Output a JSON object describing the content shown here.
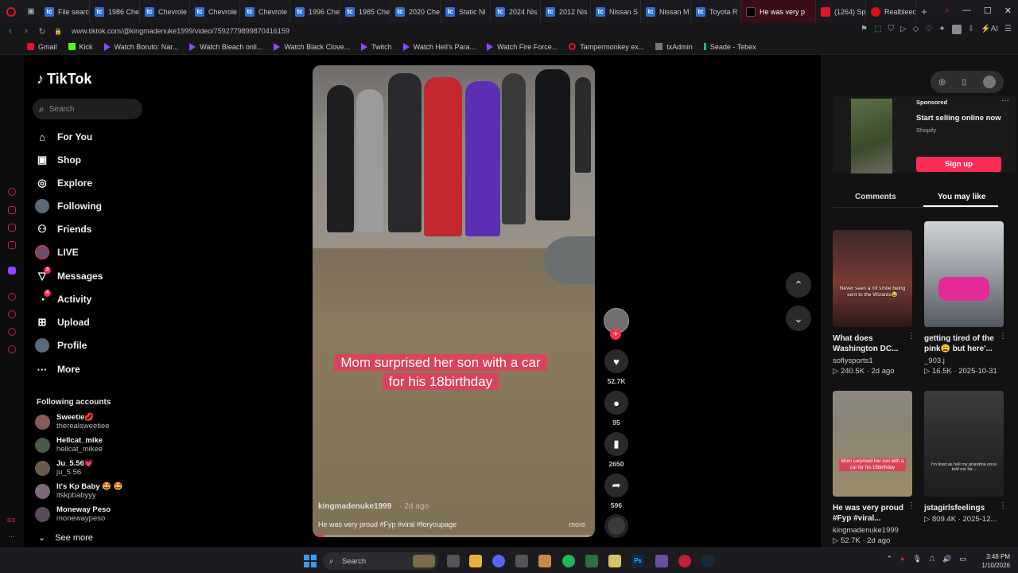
{
  "browser": {
    "tabs": [
      {
        "label": "File searc",
        "icon": "tc"
      },
      {
        "label": "1986 Che",
        "icon": "tc"
      },
      {
        "label": "Chevrole",
        "icon": "tc"
      },
      {
        "label": "Chevrole",
        "icon": "tc"
      },
      {
        "label": "Chevrole",
        "icon": "tc"
      },
      {
        "label": "1996 Che",
        "icon": "tc"
      },
      {
        "label": "1985 Che",
        "icon": "tc"
      },
      {
        "label": "2020 Che",
        "icon": "tc"
      },
      {
        "label": "Static Ni",
        "icon": "tc"
      },
      {
        "label": "2024 Nis",
        "icon": "tc"
      },
      {
        "label": "2012 Nis",
        "icon": "tc"
      },
      {
        "label": "Nissan S",
        "icon": "tc"
      },
      {
        "label": "Nissan M",
        "icon": "tc"
      },
      {
        "label": "Toyota R",
        "icon": "tc"
      },
      {
        "label": "He was very p",
        "icon": "tiktok",
        "active": true
      },
      {
        "label": "(1264) Sp",
        "icon": "youtube"
      },
      {
        "label": "Realbleed",
        "icon": "rb"
      }
    ],
    "url": "www.tiktok.com/@kingmadenuke1999/video/7592779899870416159",
    "bookmarks": [
      {
        "label": "Gmail",
        "icon": "yt"
      },
      {
        "label": "Kick",
        "icon": "kick"
      },
      {
        "label": "Watch Boruto: Nar...",
        "icon": "cr"
      },
      {
        "label": "Watch Bleach onli...",
        "icon": "cr"
      },
      {
        "label": "Watch Black Clove...",
        "icon": "cr"
      },
      {
        "label": "Twitch",
        "icon": "tw"
      },
      {
        "label": "Watch Hell's Para...",
        "icon": "cr"
      },
      {
        "label": "Watch Fire Force...",
        "icon": "cr"
      },
      {
        "label": "Tampermonkey ex...",
        "icon": "tm"
      },
      {
        "label": "txAdmin",
        "icon": "tx"
      },
      {
        "label": "Seade - Tebex",
        "icon": "sd"
      }
    ]
  },
  "tiktok": {
    "logo_text": "TikTok",
    "search_placeholder": "Search",
    "nav": [
      {
        "label": "For You",
        "icon": "home-icon",
        "glyph": "⌂"
      },
      {
        "label": "Shop",
        "icon": "shop-icon",
        "glyph": "▣"
      },
      {
        "label": "Explore",
        "icon": "compass-icon",
        "glyph": "◎"
      },
      {
        "label": "Following",
        "icon": "following-avatar-icon",
        "glyph": ""
      },
      {
        "label": "Friends",
        "icon": "friends-icon",
        "glyph": "⚇"
      },
      {
        "label": "LIVE",
        "icon": "live-icon",
        "glyph": ""
      },
      {
        "label": "Messages",
        "icon": "messages-icon",
        "glyph": "▽",
        "badge": "3"
      },
      {
        "label": "Activity",
        "icon": "activity-icon",
        "glyph": "◔",
        "badge": "4"
      },
      {
        "label": "Upload",
        "icon": "upload-icon",
        "glyph": "⊞"
      },
      {
        "label": "Profile",
        "icon": "profile-avatar-icon",
        "glyph": ""
      },
      {
        "label": "More",
        "icon": "more-icon",
        "glyph": "···"
      }
    ],
    "following_title": "Following accounts",
    "following": [
      {
        "name": "Sweetie💋",
        "handle": "therealsweetiee"
      },
      {
        "name": "Hellcat_mike",
        "handle": "hellcat_mikee"
      },
      {
        "name": "Ju_5.56💗",
        "handle": "ju_5.56"
      },
      {
        "name": "It's Kp Baby 🤩 🤩",
        "handle": "itskpbabyyy"
      },
      {
        "name": "Moneway Peso",
        "handle": "monewaypeso"
      }
    ],
    "see_more": "See more"
  },
  "video": {
    "caption": "Mom surprised her son with a car for his 18birthday",
    "author": "kingmadenuke1999",
    "ago": "· 2d ago",
    "description": "He was very proud #Fyp #viral #foryoupage",
    "more": "more",
    "progress": 0.04,
    "likes": "52.7K",
    "comments": "95",
    "saves": "2650",
    "shares": "596"
  },
  "panel": {
    "ad": {
      "sponsored": "Sponsored",
      "title": "Start selling online now",
      "brand": "Shopify",
      "cta": "Sign up"
    },
    "tabs": [
      "Comments",
      "You may like"
    ],
    "cards": [
      {
        "title": "What does Washington DC...",
        "author": "soflysports1",
        "meta": "▷ 240.5K · 2d ago",
        "overlay": "Never seen a mf smile being sent to the Wizards😂"
      },
      {
        "title": "getting tired of the pink😩 but here'...",
        "author": "_903.j",
        "meta": "▷ 16.5K · 2025-10-31",
        "overlay": ""
      },
      {
        "title": "He was very proud #Fyp #viral...",
        "author": "kingmadenuke1999",
        "meta": "▷ 52.7K · 2d ago",
        "overlay": "Mom surprised her son with a car for his 18birthday"
      },
      {
        "title": "jstagirlsfeelings",
        "author": "",
        "meta": "▷ 809.4K · 2025-12...",
        "overlay": "I'm tired as hell my grandma once told me for..."
      }
    ]
  },
  "taskbar": {
    "search": "Search",
    "time": "3:48 PM",
    "date": "1/10/2026"
  }
}
